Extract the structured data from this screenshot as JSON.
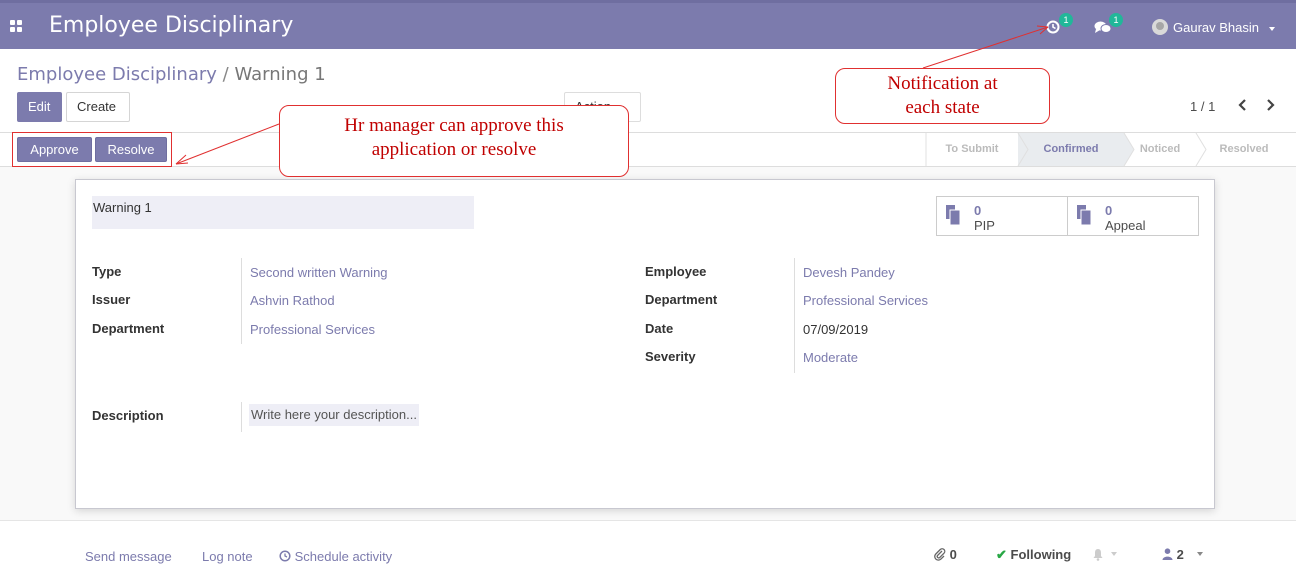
{
  "navbar": {
    "title": "Employee Disciplinary",
    "activity_badge": "1",
    "messages_badge": "1",
    "user_name": "Gaurav Bhasin"
  },
  "breadcrumb": {
    "parent": "Employee Disciplinary",
    "separator": "/",
    "current": "Warning 1"
  },
  "control": {
    "edit_label": "Edit",
    "create_label": "Create",
    "action_label": "Action",
    "pager": "1 / 1"
  },
  "statusbar": {
    "approve_label": "Approve",
    "resolve_label": "Resolve",
    "stages": [
      "To Submit",
      "Confirmed",
      "Noticed",
      "Resolved"
    ],
    "active_stage": "Confirmed"
  },
  "record": {
    "name": "Warning 1",
    "smart_buttons": [
      {
        "count": "0",
        "label": "PIP"
      },
      {
        "count": "0",
        "label": "Appeal"
      }
    ],
    "left_fields": [
      {
        "label": "Type",
        "value": "Second written Warning"
      },
      {
        "label": "Issuer",
        "value": "Ashvin Rathod"
      },
      {
        "label": "Department",
        "value": "Professional Services"
      }
    ],
    "right_fields": [
      {
        "label": "Employee",
        "value": "Devesh Pandey"
      },
      {
        "label": "Department",
        "value": "Professional Services"
      },
      {
        "label": "Date",
        "value": "07/09/2019"
      },
      {
        "label": "Severity",
        "value": "Moderate"
      }
    ],
    "description_label": "Description",
    "description_placeholder": "Write here your description..."
  },
  "chatter": {
    "send_message": "Send message",
    "log_note": "Log note",
    "schedule_activity": "Schedule activity",
    "attachments": "0",
    "following": "Following",
    "followers": "2"
  },
  "annotations": {
    "approve_note_line1": "Hr manager  can  approve  this",
    "approve_note_line2": "application  or  resolve",
    "notification_note_line1": "Notification  at",
    "notification_note_line2": "each state"
  },
  "colors": {
    "brand": "#7c7bad",
    "badge": "#21b799",
    "annotation": "#e03030"
  }
}
